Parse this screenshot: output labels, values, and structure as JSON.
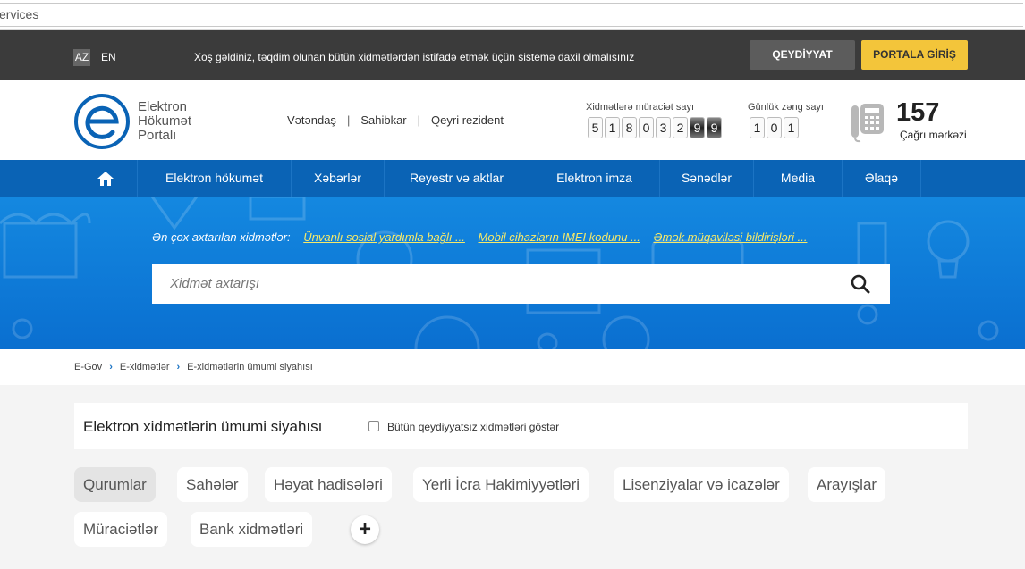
{
  "browser": {
    "url_text": "ervices"
  },
  "topbar": {
    "lang_az": "AZ",
    "lang_en": "EN",
    "welcome": "Xoş gəldiniz, təqdim olunan bütün xidmətlərdən istifadə etmək üçün sistemə daxil olmalısınız",
    "register_label": "QEYDİYYAT",
    "login_label": "PORTALA GİRİŞ"
  },
  "header": {
    "logo_line1": "Elektron",
    "logo_line2": "Hökumət",
    "logo_line3": "Portalı",
    "user_links": [
      "Vətəndaş",
      "Sahibkar",
      "Qeyri rezident"
    ],
    "separator": "|",
    "applications_label": "Xidmətlərə müraciət sayı",
    "applications_digits": [
      "5",
      "1",
      "8",
      "0",
      "3",
      "2",
      "9",
      "9"
    ],
    "calls_label": "Günlük zəng sayı",
    "calls_digits": [
      "1",
      "0",
      "1"
    ],
    "call_number": "157",
    "call_center_label": "Çağrı mərkəzi"
  },
  "nav": {
    "home_icon": "home-icon",
    "items": [
      "Elektron hökumət",
      "Xəbərlər",
      "Reyestr və aktlar",
      "Elektron imza",
      "Sənədlər",
      "Media",
      "Əlaqə"
    ]
  },
  "hero": {
    "popular_label": "Ən çox axtarılan xidmətlər:",
    "popular_links": [
      "Ünvanlı sosial yardımla bağlı ...",
      "Mobil cihazların IMEI kodunu ...",
      "Əmək müqaviləsi bildirişləri ..."
    ],
    "search_placeholder": "Xidmət axtarışı",
    "search_icon": "search-icon"
  },
  "breadcrumb": [
    "E-Gov",
    "E-xidmətlər",
    "E-xidmətlərin ümumi siyahısı"
  ],
  "breadcrumb_separator": "›",
  "list": {
    "title": "Elektron xidmətlərin ümumi siyahısı",
    "checkbox_label": "Bütün qeydiyyatsız xidmətləri göstər",
    "tabs": [
      "Qurumlar",
      "Sahələr",
      "Həyat hadisələri",
      "Yerli İcra Hakimiyyətləri",
      "Lisenziyalar və icazələr",
      "Arayışlar",
      "Müraciətlər",
      "Bank xidmətləri"
    ],
    "active_tab": "Qurumlar",
    "more_label": "+"
  },
  "colors": {
    "nav_blue": "#0a63b5",
    "hero_blue": "#1488e0",
    "accent_yellow": "#f3c53a",
    "topbar_dark": "#3b3b3b"
  }
}
